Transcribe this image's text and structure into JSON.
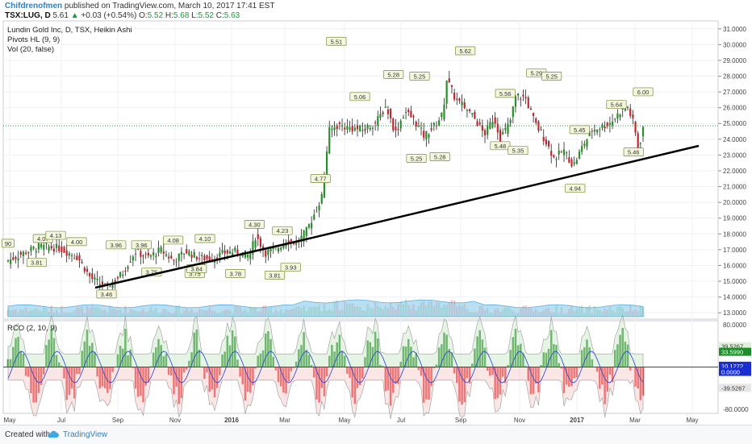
{
  "header": {
    "user": "Chifdrenofmen",
    "published": "published on TradingView.com, March 10, 2017 17:41 EST",
    "symbol": "TSX:LUG, D",
    "last": "5.61",
    "change": "+0.03 (+0.54%)",
    "o_label": "O:",
    "o": "5.52",
    "h_label": "H:",
    "h": "5.68",
    "l_label": "L:",
    "l": "5.52",
    "c_label": "C:",
    "c": "5.63"
  },
  "legend": {
    "title": "Lundin Gold Inc, D, TSX, Heikin Ashi",
    "pivots": "Pivots HL (9, 9)",
    "vol": "Vol (20, false)"
  },
  "oscillator": {
    "label": "RCO (2, 10, 9)",
    "ticks": [
      "80.0000",
      "-80.0000"
    ],
    "badges": [
      {
        "text": "39.5267",
        "color": "#dff0d8"
      },
      {
        "text": "33.5990",
        "color": "#1e8e2a"
      },
      {
        "text": "10.1272",
        "color": "#1a2fcf"
      },
      {
        "text": "0.0000",
        "color": "#1a2fcf"
      },
      {
        "text": "-39.5267",
        "color": "#e6e6e6"
      }
    ]
  },
  "footer": {
    "created": "Created with",
    "brand": "TradingView"
  },
  "chart_data": {
    "type": "candlestick",
    "title": "Lundin Gold Inc, D, TSX, Heikin Ashi",
    "x_ticks": [
      "May",
      "Jul",
      "Sep",
      "Nov",
      "2016",
      "Mar",
      "May",
      "Jul",
      "Sep",
      "Nov",
      "2017",
      "Mar",
      "May"
    ],
    "y_ticks": [
      "31.0000",
      "30.0000",
      "29.0000",
      "28.0000",
      "27.0000",
      "26.0000",
      "25.0000",
      "24.0000",
      "23.0000",
      "22.0000",
      "21.0000",
      "20.0000",
      "19.0000",
      "18.0000",
      "17.0000",
      "16.0000",
      "15.0000",
      "14.0000",
      "13.0000"
    ],
    "ylim": [
      12.6,
      31.5
    ],
    "price_path": [
      [
        0,
        16.3
      ],
      [
        0.03,
        16.9
      ],
      [
        0.05,
        17.2
      ],
      [
        0.08,
        17.1
      ],
      [
        0.11,
        16.5
      ],
      [
        0.13,
        15.2
      ],
      [
        0.155,
        14.6
      ],
      [
        0.18,
        15.5
      ],
      [
        0.2,
        16.9
      ],
      [
        0.22,
        16.5
      ],
      [
        0.24,
        17.0
      ],
      [
        0.26,
        16.3
      ],
      [
        0.28,
        16.9
      ],
      [
        0.3,
        16.5
      ],
      [
        0.32,
        16.4
      ],
      [
        0.34,
        16.8
      ],
      [
        0.36,
        16.9
      ],
      [
        0.38,
        16.6
      ],
      [
        0.39,
        17.9
      ],
      [
        0.405,
        16.8
      ],
      [
        0.42,
        17.0
      ],
      [
        0.44,
        17.6
      ],
      [
        0.455,
        17.4
      ],
      [
        0.47,
        18.2
      ],
      [
        0.485,
        19.5
      ],
      [
        0.495,
        20.5
      ],
      [
        0.505,
        24.5
      ],
      [
        0.52,
        24.9
      ],
      [
        0.54,
        24.7
      ],
      [
        0.56,
        24.6
      ],
      [
        0.58,
        25.1
      ],
      [
        0.595,
        26.1
      ],
      [
        0.61,
        24.4
      ],
      [
        0.625,
        25.8
      ],
      [
        0.64,
        25.2
      ],
      [
        0.655,
        24.2
      ],
      [
        0.67,
        24.8
      ],
      [
        0.685,
        25.6
      ],
      [
        0.69,
        27.9
      ],
      [
        0.705,
        26.5
      ],
      [
        0.72,
        26.0
      ],
      [
        0.735,
        25.3
      ],
      [
        0.75,
        24.3
      ],
      [
        0.765,
        25.4
      ],
      [
        0.775,
        24.1
      ],
      [
        0.79,
        25.0
      ],
      [
        0.8,
        26.8
      ],
      [
        0.815,
        26.6
      ],
      [
        0.83,
        25.0
      ],
      [
        0.845,
        24.0
      ],
      [
        0.86,
        22.8
      ],
      [
        0.875,
        23.3
      ],
      [
        0.89,
        22.3
      ],
      [
        0.905,
        23.6
      ],
      [
        0.92,
        24.6
      ],
      [
        0.935,
        24.8
      ],
      [
        0.95,
        25.1
      ],
      [
        0.965,
        25.8
      ],
      [
        0.975,
        26.1
      ],
      [
        0.985,
        25.0
      ],
      [
        0.993,
        23.3
      ],
      [
        1.0,
        24.8
      ]
    ],
    "pivot_labels": [
      {
        "t": 0.0,
        "v": 17.0,
        "text": "90",
        "pos": "above"
      },
      {
        "t": 0.055,
        "v": 17.3,
        "text": "4.07",
        "pos": "above"
      },
      {
        "t": 0.075,
        "v": 17.5,
        "text": "4.13",
        "pos": "above"
      },
      {
        "t": 0.045,
        "v": 16.6,
        "text": "3.81",
        "pos": "below"
      },
      {
        "t": 0.108,
        "v": 17.1,
        "text": "4.00",
        "pos": "above"
      },
      {
        "t": 0.155,
        "v": 14.6,
        "text": "3.46",
        "pos": "below"
      },
      {
        "t": 0.17,
        "v": 16.9,
        "text": "3.96",
        "pos": "above"
      },
      {
        "t": 0.21,
        "v": 16.9,
        "text": "3.96",
        "pos": "above"
      },
      {
        "t": 0.226,
        "v": 16.0,
        "text": "3.75",
        "pos": "below"
      },
      {
        "t": 0.26,
        "v": 17.2,
        "text": "4.08",
        "pos": "above"
      },
      {
        "t": 0.294,
        "v": 15.9,
        "text": "3.75",
        "pos": "below"
      },
      {
        "t": 0.31,
        "v": 17.3,
        "text": "4.10",
        "pos": "above"
      },
      {
        "t": 0.297,
        "v": 16.2,
        "text": "3.84",
        "pos": "below"
      },
      {
        "t": 0.358,
        "v": 15.9,
        "text": "3.78",
        "pos": "below"
      },
      {
        "t": 0.388,
        "v": 18.2,
        "text": "4.30",
        "pos": "above"
      },
      {
        "t": 0.42,
        "v": 15.8,
        "text": "3.81",
        "pos": "below"
      },
      {
        "t": 0.432,
        "v": 17.8,
        "text": "4.23",
        "pos": "above"
      },
      {
        "t": 0.445,
        "v": 16.3,
        "text": "3.93",
        "pos": "below"
      },
      {
        "t": 0.492,
        "v": 21.1,
        "text": "4.77",
        "pos": "above"
      },
      {
        "t": 0.517,
        "v": 29.8,
        "text": "5.51",
        "pos": "above"
      },
      {
        "t": 0.554,
        "v": 26.3,
        "text": "5.06",
        "pos": "above"
      },
      {
        "t": 0.607,
        "v": 27.7,
        "text": "5.28",
        "pos": "above"
      },
      {
        "t": 0.648,
        "v": 27.6,
        "text": "5.25",
        "pos": "above"
      },
      {
        "t": 0.643,
        "v": 23.2,
        "text": "5.25",
        "pos": "below"
      },
      {
        "t": 0.68,
        "v": 23.3,
        "text": "5.28",
        "pos": "below"
      },
      {
        "t": 0.72,
        "v": 29.2,
        "text": "5.62",
        "pos": "above"
      },
      {
        "t": 0.783,
        "v": 26.5,
        "text": "5.56",
        "pos": "above"
      },
      {
        "t": 0.775,
        "v": 24.0,
        "text": "5.48",
        "pos": "below"
      },
      {
        "t": 0.803,
        "v": 23.7,
        "text": "5.35",
        "pos": "below"
      },
      {
        "t": 0.832,
        "v": 27.8,
        "text": "5.29",
        "pos": "above"
      },
      {
        "t": 0.856,
        "v": 27.6,
        "text": "5.25",
        "pos": "above"
      },
      {
        "t": 0.9,
        "v": 24.2,
        "text": "5.45",
        "pos": "above"
      },
      {
        "t": 0.893,
        "v": 21.3,
        "text": "4.94",
        "pos": "below"
      },
      {
        "t": 0.958,
        "v": 25.8,
        "text": "5.64",
        "pos": "above"
      },
      {
        "t": 0.985,
        "v": 23.6,
        "text": "5.46",
        "pos": "below"
      },
      {
        "t": 1.0,
        "v": 26.6,
        "text": "6.00",
        "pos": "above"
      }
    ],
    "oscillator": {
      "name": "RCO (2, 10, 9)",
      "ylim": [
        -88,
        88
      ]
    }
  }
}
